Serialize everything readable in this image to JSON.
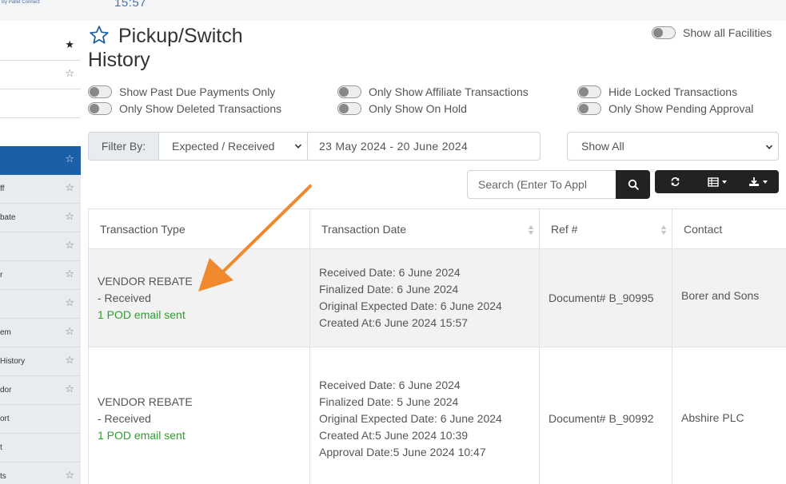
{
  "header": {
    "brand": "By Pallet Connect",
    "clock": "15:57"
  },
  "sidebar": {
    "items": [
      {
        "label": "",
        "star": "★",
        "active": false
      },
      {
        "label": "",
        "star": "☆",
        "active": false
      },
      {
        "label": "",
        "star": "",
        "active": false
      },
      {
        "label": "",
        "star": "",
        "active": false
      },
      {
        "label": "",
        "star": "☆",
        "active": true
      },
      {
        "label": "ff",
        "star": "☆",
        "active": false
      },
      {
        "label": "bate",
        "star": "☆",
        "active": false
      },
      {
        "label": "",
        "star": "☆",
        "active": false
      },
      {
        "label": "r",
        "star": "☆",
        "active": false
      },
      {
        "label": "",
        "star": "☆",
        "active": false
      },
      {
        "label": "em",
        "star": "☆",
        "active": false
      },
      {
        "label": "History",
        "star": "☆",
        "active": false
      },
      {
        "label": "dor",
        "star": "☆",
        "active": false
      },
      {
        "label": "ort",
        "star": "",
        "active": false
      },
      {
        "label": "t",
        "star": "",
        "active": false
      },
      {
        "label": "ts",
        "star": "☆",
        "active": false
      }
    ]
  },
  "page": {
    "title": "Pickup/Switch History",
    "show_all_facilities": "Show all Facilities"
  },
  "toggles": {
    "past_due": "Show Past Due Payments Only",
    "deleted": "Only Show Deleted Transactions",
    "affiliate": "Only Show Affiliate Transactions",
    "on_hold": "Only Show On Hold",
    "locked": "Hide Locked Transactions",
    "pending": "Only Show Pending Approval"
  },
  "filter": {
    "label": "Filter By:",
    "type_value": "Expected / Received",
    "date_range": "23 May 2024 - 20 June 2024",
    "show_value": "Show All"
  },
  "search": {
    "placeholder": "Search (Enter To Appl"
  },
  "table": {
    "headers": [
      "Transaction Type",
      "Transaction Date",
      "Ref #",
      "Contact"
    ],
    "rows": [
      {
        "type_line1": "VENDOR REBATE",
        "type_line2": "- Received",
        "pod": "1 POD email sent",
        "dates": [
          "Received Date: 6 June 2024",
          "Finalized Date: 6 June 2024",
          "Original Expected Date: 6 June 2024",
          "Created At:6 June 2024 15:57"
        ],
        "ref": "Document# B_90995",
        "contact": "Borer and Sons"
      },
      {
        "type_line1": "VENDOR REBATE",
        "type_line2": "- Received",
        "pod": "1 POD email sent",
        "dates": [
          "Received Date: 6 June 2024",
          "Finalized Date: 5 June 2024",
          "Original Expected Date: 6 June 2024",
          "Created At:5 June 2024 10:39",
          "Approval Date:5 June 2024 10:47"
        ],
        "ref": "Document# B_90992",
        "contact": "Abshire PLC"
      }
    ]
  },
  "colors": {
    "accent": "#1b5fa6",
    "pod_green": "#2ca02c",
    "annotation_arrow": "#f0892e",
    "toolbar_dark": "#222222"
  }
}
